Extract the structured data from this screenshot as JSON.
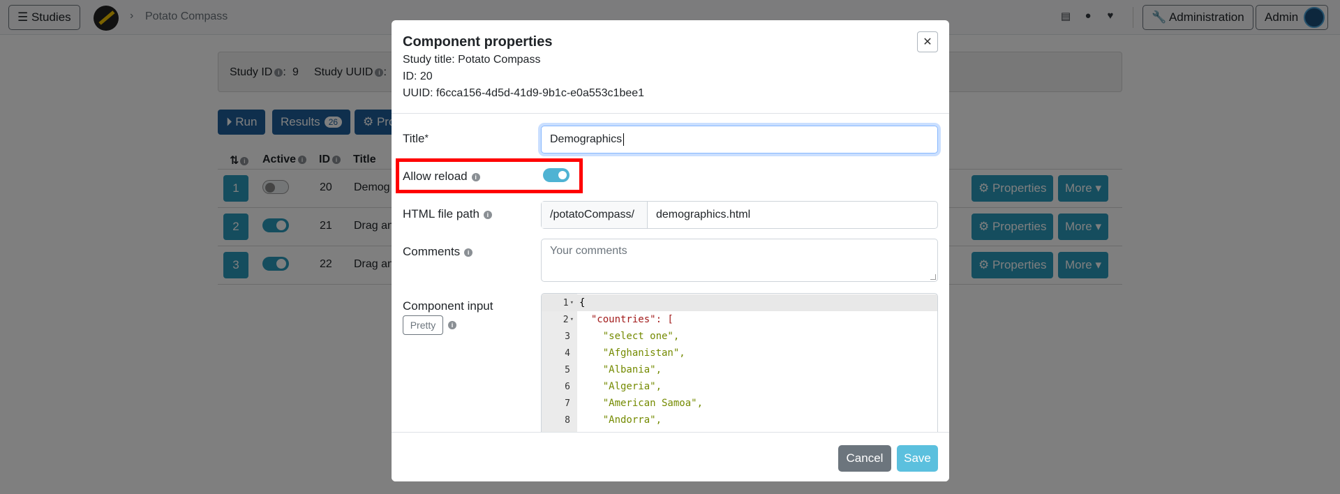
{
  "topbar": {
    "studies_label": "☰ Studies",
    "breadcrumb": "Potato Compass",
    "icons": [
      "file-icon",
      "github-icon",
      "heart-icon"
    ],
    "admin_label": "🔧 Administration",
    "user_label": "Admin"
  },
  "info": {
    "study_id_label": "Study ID",
    "study_id_value": "9",
    "study_uuid_label": "Study UUID"
  },
  "actions": {
    "run": "⏵ Run",
    "results": "Results",
    "results_count": "26",
    "properties_partial": "⚙ Pro"
  },
  "table": {
    "headers": {
      "sort": "⇅",
      "active": "Active",
      "id": "ID",
      "title": "Title"
    },
    "rows": [
      {
        "pos": "1",
        "active": false,
        "id": "20",
        "title": "Demog"
      },
      {
        "pos": "2",
        "active": true,
        "id": "21",
        "title": "Drag an"
      },
      {
        "pos": "3",
        "active": true,
        "id": "22",
        "title": "Drag an"
      }
    ],
    "properties_label": "⚙ Properties",
    "more_label": "More ▾"
  },
  "modal": {
    "title": "Component properties",
    "study_title_label": "Study title:",
    "study_title_value": "Potato Compass",
    "id_label": "ID:",
    "id_value": "20",
    "uuid_label": "UUID:",
    "uuid_value": "f6cca156-4d5d-41d9-9b1c-e0a553c1bee1",
    "close_label": "✕",
    "fields": {
      "title_label": "Title",
      "title_required": "*",
      "title_value": "Demographics",
      "allow_reload_label": "Allow reload",
      "allow_reload_on": true,
      "html_path_label": "HTML file path",
      "html_path_prefix": "/potatoCompass/",
      "html_path_value": "demographics.html",
      "comments_label": "Comments",
      "comments_placeholder": "Your comments",
      "component_input_label": "Component input",
      "pretty_label": "Pretty"
    },
    "editor": {
      "line_numbers": [
        "1",
        "2",
        "3",
        "4",
        "5",
        "6",
        "7",
        "8"
      ],
      "lines": [
        "{",
        "  \"countries\": [",
        "    \"select one\",",
        "    \"Afghanistan\",",
        "    \"Albania\",",
        "    \"Algeria\",",
        "    \"American Samoa\",",
        "    \"Andorra\","
      ]
    },
    "cancel_label": "Cancel",
    "save_label": "Save"
  }
}
